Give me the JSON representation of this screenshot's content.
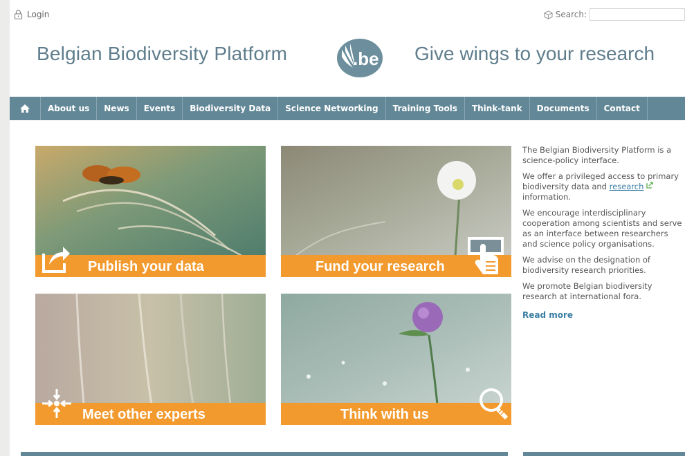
{
  "topbar": {
    "login_label": "Login",
    "search_label": "Search:",
    "search_value": ""
  },
  "header": {
    "title": "Belgian Biodiversity Platform",
    "logo_text": ".be",
    "tagline": "Give wings to your research"
  },
  "nav": {
    "items": [
      {
        "label": "About us"
      },
      {
        "label": "News"
      },
      {
        "label": "Events"
      },
      {
        "label": "Biodiversity Data"
      },
      {
        "label": "Science Networking"
      },
      {
        "label": "Training Tools"
      },
      {
        "label": "Think-tank"
      },
      {
        "label": "Documents"
      },
      {
        "label": "Contact"
      }
    ]
  },
  "tiles": [
    {
      "label": "Publish your data",
      "icon": "share-arrow-icon"
    },
    {
      "label": "Fund your research",
      "icon": "hand-card-icon"
    },
    {
      "label": "Meet other experts",
      "icon": "converge-arrows-icon"
    },
    {
      "label": "Think with us",
      "icon": "lightbulb-icon"
    }
  ],
  "intro": {
    "p1": "The Belgian Biodiversity Platform is a science-policy interface.",
    "p2_before": "We offer a privileged access to primary biodiversity data and ",
    "p2_link": "research",
    "p2_after": " information.",
    "p3": "We encourage interdisciplinary cooperation among scientists and serve as an interface between researchers and science policy organisations.",
    "p4": "We advise on the designation of biodiversity research priorities.",
    "p5": "We promote Belgian biodiversity research at international fora.",
    "read_more": "Read more"
  },
  "colors": {
    "nav": "#628796",
    "title": "#5f7d8c",
    "tile_band": "#f39a2e",
    "link": "#3a7ea3"
  }
}
